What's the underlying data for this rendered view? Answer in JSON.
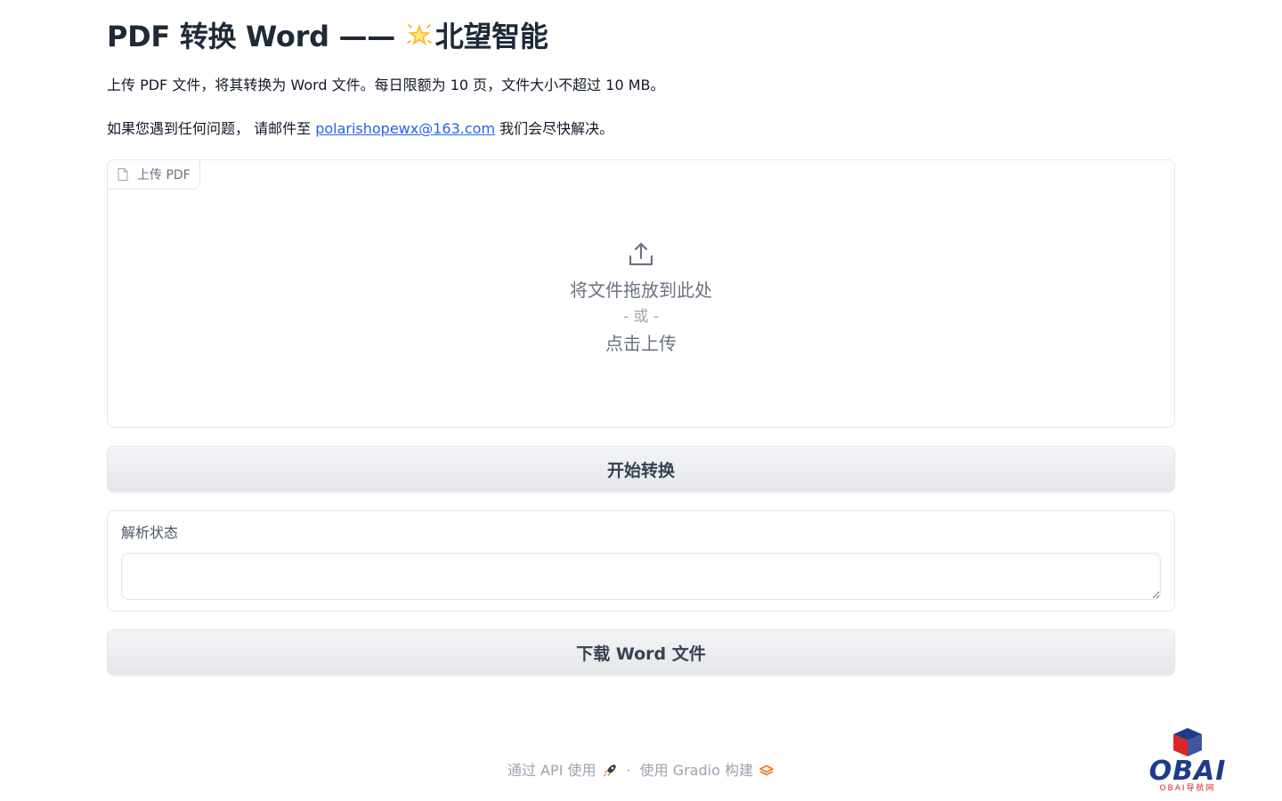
{
  "header": {
    "title_prefix": "PDF 转换 Word —— ",
    "title_suffix": "北望智能"
  },
  "description": {
    "line1": "上传 PDF 文件，将其转换为 Word 文件。每日限额为 10 页，文件大小不超过 10 MB。",
    "line2_before": "如果您遇到任何问题， 请邮件至 ",
    "email": "polarishopewx@163.com",
    "line2_after": " 我们会尽快解决。"
  },
  "upload": {
    "label": "上传 PDF",
    "drop_text": "将文件拖放到此处",
    "or_text": "- 或 -",
    "click_text": "点击上传"
  },
  "buttons": {
    "convert": "开始转换",
    "download": "下载 Word 文件"
  },
  "status": {
    "label": "解析状态",
    "value": ""
  },
  "footer": {
    "api_text": "通过 API 使用",
    "separator": "·",
    "built_text": "使用 Gradio 构建"
  },
  "watermark": {
    "text": "OBAI",
    "sub": "OBAI导航网"
  },
  "colors": {
    "accent_link": "#2563eb",
    "gradio_orange": "#f97316"
  }
}
